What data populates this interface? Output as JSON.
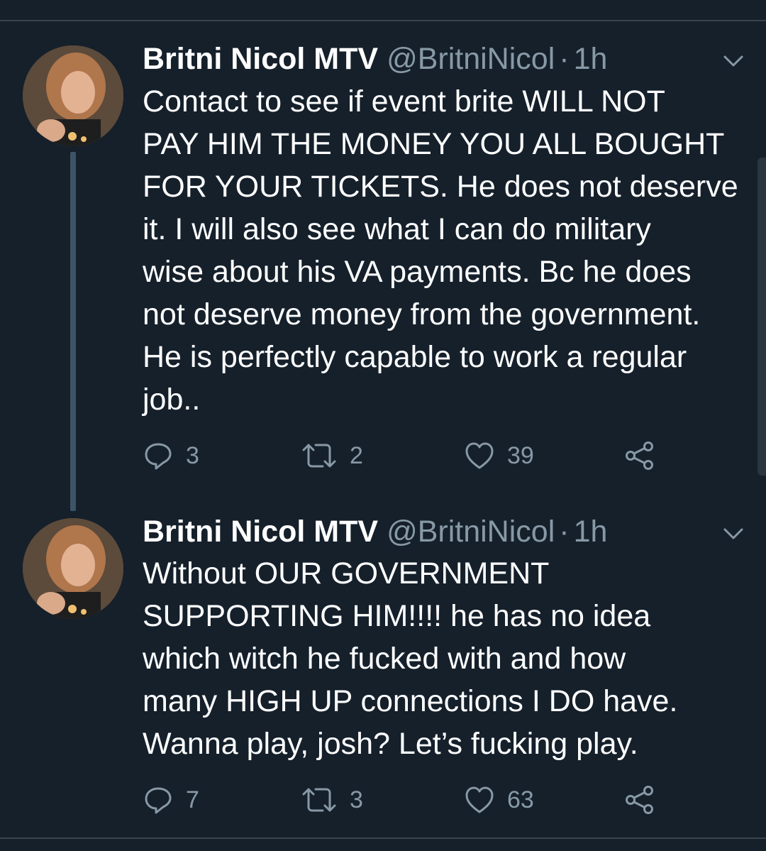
{
  "tweets": [
    {
      "name": "Britni Nicol MTV",
      "handle": "@BritniNicol",
      "separator": "·",
      "time": "1h",
      "lines": [
        "Contact to see if event brite WILL NOT",
        "PAY HIM THE MONEY YOU ALL BOUGHT",
        "FOR YOUR TICKETS. He does not deserve",
        "it. I will also see what I can do military",
        "wise about his VA payments. Bc he does",
        "not deserve money from the government.",
        "He is perfectly capable to work a regular",
        "job.."
      ],
      "replies": "3",
      "retweets": "2",
      "likes": "39"
    },
    {
      "name": "Britni Nicol MTV",
      "handle": "@BritniNicol",
      "separator": "·",
      "time": "1h",
      "lines": [
        "Without OUR GOVERNMENT",
        "SUPPORTING HIM!!!! he has no idea",
        "which witch he fucked with and how",
        "many HIGH UP connections I DO have.",
        "Wanna play, josh? Let’s fucking play."
      ],
      "replies": "7",
      "retweets": "3",
      "likes": "63"
    }
  ],
  "icons": {
    "reply": "reply-icon",
    "retweet": "retweet-icon",
    "like": "heart-icon",
    "share": "share-icon",
    "menu": "chevron-down-icon"
  },
  "colors": {
    "background": "#15202b",
    "primary_text": "#ffffff",
    "secondary_text": "#8899a6",
    "thread_line": "#3d5466",
    "divider": "#38444d"
  }
}
